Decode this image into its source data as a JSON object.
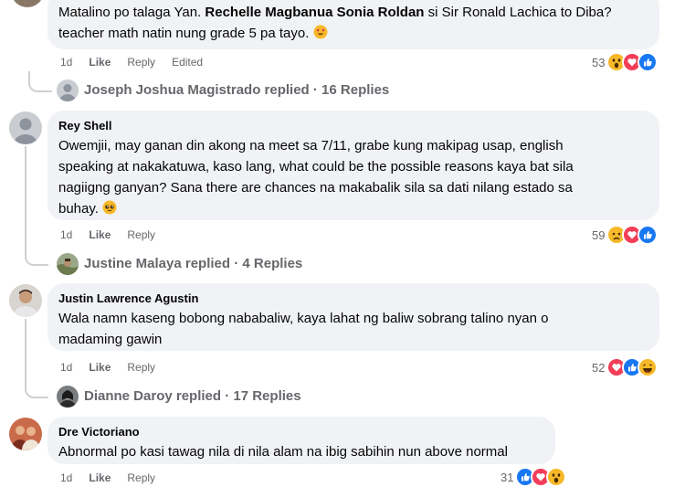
{
  "comments": [
    {
      "author": "",
      "text_line1_pre": "Matalino po talaga Yan.",
      "text_line1_bold": "Rechelle Magbanua Sonia Roldan",
      "text_line1_post": "si Sir Ronald Lachica to Diba?",
      "text_line2": "teacher math natin nung grade 5 pa tayo.",
      "time": "1d",
      "like_label": "Like",
      "reply_label": "Reply",
      "edited_label": "Edited",
      "reaction_count": "53",
      "reactions": [
        "wow-icon",
        "love-icon",
        "like-icon"
      ]
    },
    {
      "author": "Rey Shell",
      "lines": [
        "Owemjii, may ganan din akong na meet sa 7/11, grabe kung makipag usap, english",
        "speaking at nakakatuwa, kaso lang, what could be the possible reasons kaya bat sila",
        "nagiigng ganyan? Sana there are chances na makabalik sila sa dati nilang estado sa",
        "buhay."
      ],
      "time": "1d",
      "like_label": "Like",
      "reply_label": "Reply",
      "reaction_count": "59",
      "reactions": [
        "sad-icon",
        "love-icon",
        "like-icon"
      ]
    },
    {
      "author": "Justin Lawrence Agustin",
      "lines": [
        "Wala namn kaseng bobong nababaliw, kaya lahat ng baliw sobrang talino nyan o",
        "madaming gawin"
      ],
      "time": "1d",
      "like_label": "Like",
      "reply_label": "Reply",
      "reaction_count": "52",
      "reactions": [
        "love-icon",
        "like-icon",
        "haha-icon"
      ]
    },
    {
      "author": "Dre Victoriano",
      "lines": [
        "Abnormal po kasi tawag nila di nila alam na ibig sabihin nun above normal"
      ],
      "time": "1d",
      "like_label": "Like",
      "reply_label": "Reply",
      "reaction_count": "31",
      "reactions": [
        "like-icon",
        "love-icon",
        "wow-icon"
      ]
    }
  ],
  "replies": [
    {
      "text": "Joseph Joshua Magistrado replied · 16 Replies"
    },
    {
      "text": "Justine Malaya replied · 4 Replies"
    },
    {
      "text": "Dianne Daroy replied · 17 Replies"
    }
  ],
  "colors": {
    "bubble": "#f0f2f5",
    "secondary_text": "#65676b",
    "like_blue": "#1877f2",
    "love_red": "#f33e58",
    "emoji_yellow": "#f7b928"
  }
}
